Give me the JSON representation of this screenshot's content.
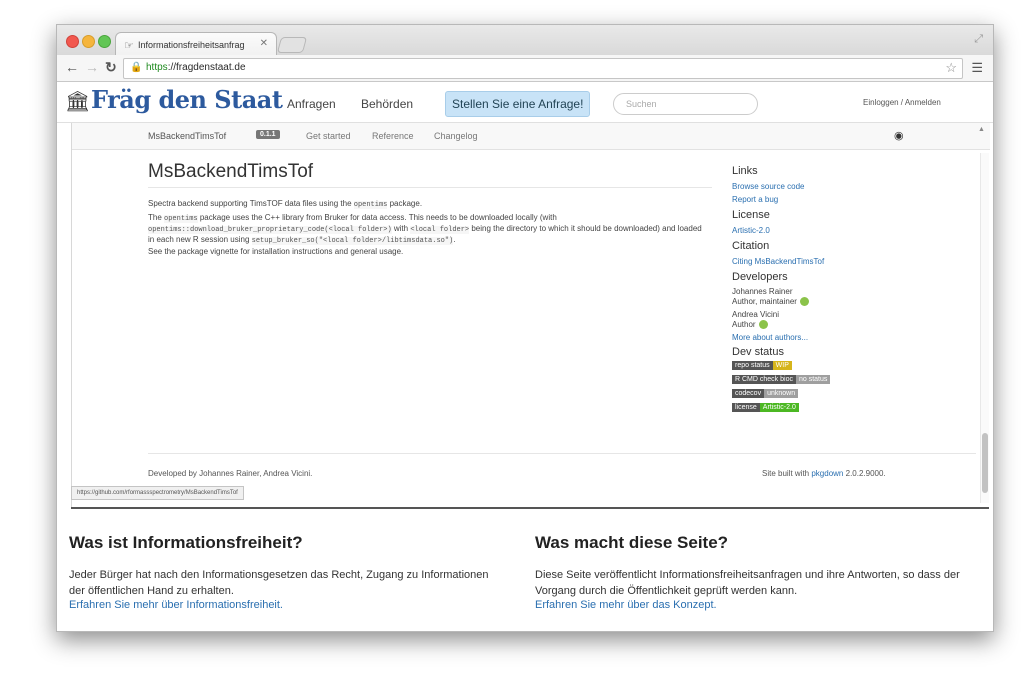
{
  "browser": {
    "tab_title": "Informationsfreiheitsanfrag",
    "url_scheme": "https",
    "url_rest": "://fragdenstaat.de"
  },
  "site": {
    "logo": "Fräg den Staat",
    "nav": [
      "Anfragen",
      "Behörden"
    ],
    "cta": "Stellen Sie eine Anfrage!",
    "search_placeholder": "Suchen",
    "login": "Einloggen / Anmelden"
  },
  "pkgdown": {
    "name": "MsBackendTimsTof",
    "version": "0.1.1",
    "nav": [
      "Get started",
      "Reference",
      "Changelog"
    ],
    "title": "MsBackendTimsTof",
    "p1_pre": "Spectra backend supporting TimsTOF data files using the ",
    "p1_code": "opentims",
    "p1_post": " package.",
    "p2_pre": "The ",
    "p2_code1": "opentims",
    "p2_mid1": " package uses the C++ library from Bruker for data access. This needs to be downloaded locally (with ",
    "p2_code2": "opentims::download_bruker_proprietary_code(<local folder>)",
    "p2_mid2": " with ",
    "p2_code3": "<local folder>",
    "p2_mid3": " being the directory to which it should be downloaded) and loaded in each new R session using ",
    "p2_code4": "setup_bruker_so(\"<local folder>/libtimsdata.so\")",
    "p2_post": ".",
    "p3": "See the package vignette for installation instructions and general usage.",
    "sidebar": {
      "links_h": "Links",
      "links": [
        "Browse source code",
        "Report a bug"
      ],
      "license_h": "License",
      "license": "Artistic-2.0",
      "citation_h": "Citation",
      "citation": "Citing MsBackendTimsTof",
      "developers_h": "Developers",
      "dev1_name": "Johannes Rainer",
      "dev1_role": "Author, maintainer",
      "dev2_name": "Andrea Vicini",
      "dev2_role": "Author",
      "more_authors": "More about authors...",
      "devstatus_h": "Dev status",
      "badges": [
        {
          "left": "repo status",
          "right": "WIP",
          "right_color": "#d6b51b"
        },
        {
          "left": "R CMD check bioc",
          "right": "no status",
          "right_color": "#9f9f9f"
        },
        {
          "left": "codecov",
          "right": "unknown",
          "right_color": "#9f9f9f"
        },
        {
          "left": "license",
          "right": "Artistic-2.0",
          "right_color": "#4cb823"
        }
      ]
    },
    "footer_left": "Developed by Johannes Rainer, Andrea Vicini.",
    "footer_right_pre": "Site built with ",
    "footer_right_link": "pkgdown",
    "footer_right_post": " 2.0.2.9000."
  },
  "status_url": "https://github.com/rformassspectrometry/MsBackendTimsTof",
  "info": {
    "left_h": "Was ist Informationsfreiheit?",
    "left_p": "Jeder Bürger hat nach den Informationsgesetzen das Recht, Zugang zu Informationen der öffentlichen Hand zu erhalten.",
    "left_link": "Erfahren Sie mehr über Informationsfreiheit.",
    "right_h": "Was macht diese Seite?",
    "right_p": "Diese Seite veröffentlicht Informationsfreiheitsanfragen und ihre Antworten, so dass der Vorgang durch die Öffentlichkeit geprüft werden kann.",
    "right_link": "Erfahren Sie mehr über das Konzept."
  },
  "colors": {
    "logo": "#2d5a9e",
    "link": "#2a6fb0",
    "cta_bg": "#c8e3f7"
  }
}
